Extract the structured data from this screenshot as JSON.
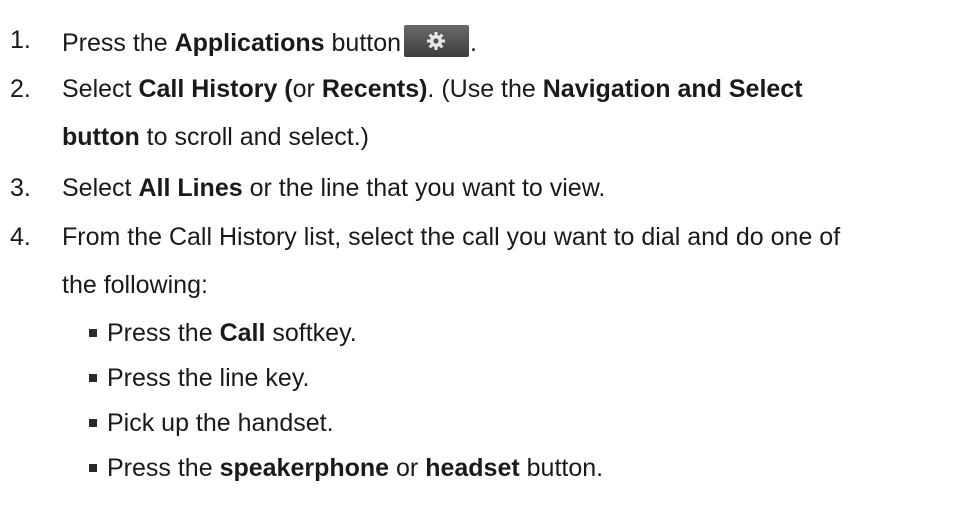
{
  "steps": [
    {
      "number": "1.",
      "parts": {
        "a": "Press the ",
        "b": "Applications",
        "c": " button",
        "d": "."
      },
      "icon": "gear-icon"
    },
    {
      "number": "2.",
      "parts": {
        "a": "Select ",
        "b": "Call History (",
        "c": "or ",
        "d": "Recents)",
        "e": ". (Use the ",
        "f": "Navigation and Select",
        "g": "button",
        "h": " to scroll and select.)"
      }
    },
    {
      "number": "3.",
      "parts": {
        "a": "Select ",
        "b": "All Lines",
        "c": " or the line that you want to view."
      }
    },
    {
      "number": "4.",
      "parts": {
        "a": "From the Call History list, select the call you want to dial and do one of",
        "b": "the following:"
      },
      "options": [
        {
          "a": "Press the ",
          "b": "Call",
          "c": " softkey."
        },
        {
          "a": "Press the line key."
        },
        {
          "a": "Pick up the handset."
        },
        {
          "a": "Press the ",
          "b": "speakerphone",
          "c": " or ",
          "d": "headset",
          "e": " button."
        }
      ]
    }
  ]
}
